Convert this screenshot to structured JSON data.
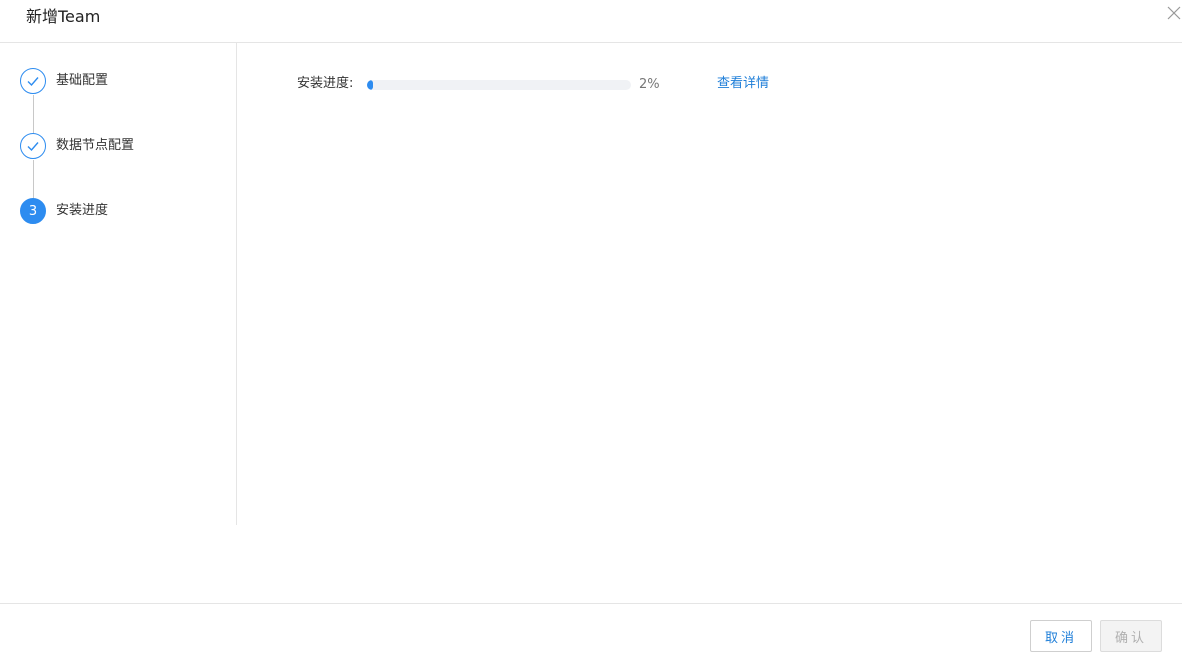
{
  "dialog": {
    "title": "新增Team"
  },
  "steps": [
    {
      "label": "基础配置",
      "status": "done",
      "icon": "check-icon"
    },
    {
      "label": "数据节点配置",
      "status": "done",
      "icon": "check-icon"
    },
    {
      "label": "安装进度",
      "status": "active",
      "number": "3"
    }
  ],
  "progress": {
    "label": "安装进度:",
    "percent_text": "2%",
    "value": 0.02,
    "details_link": "查看详情"
  },
  "footer": {
    "cancel_label": "取消",
    "confirm_label": "确认"
  },
  "colors": {
    "accent": "#2d8cf0",
    "link": "#1e7ed8",
    "border": "#e5e5e5"
  },
  "icons": {
    "close": "close-icon"
  }
}
